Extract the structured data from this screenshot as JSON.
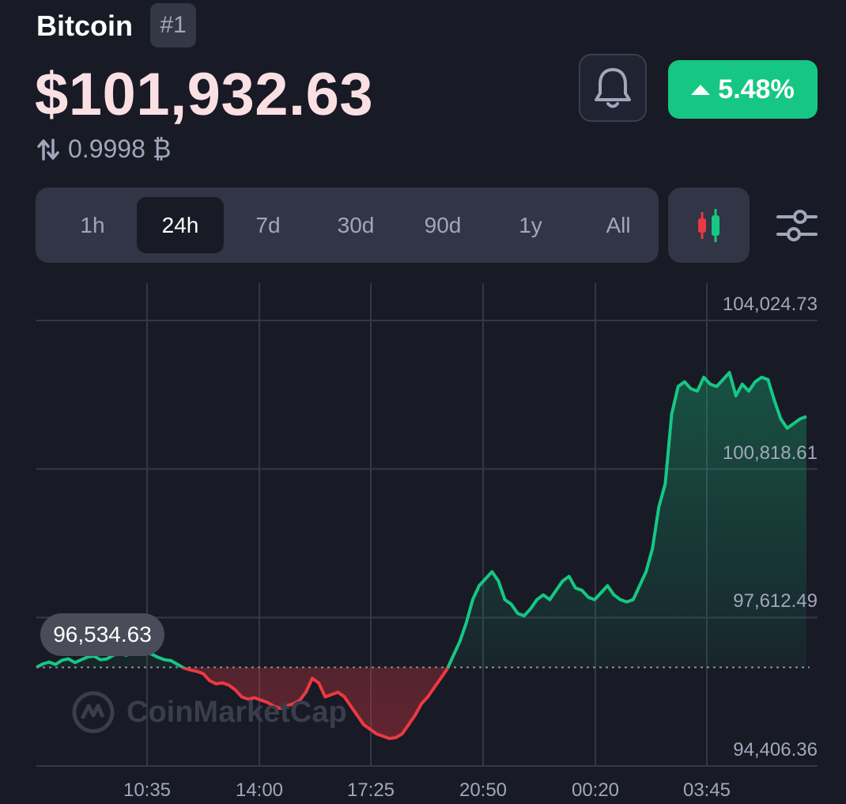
{
  "header": {
    "coin_name": "Bitcoin",
    "rank": "#1",
    "price": "$101,932.63",
    "btc_conversion": "0.9998 ₿",
    "change_percent": "5.48%"
  },
  "icons": {
    "swap": "swap-arrows-icon",
    "bell": "bell-icon",
    "change_direction": "triangle-up-icon",
    "candles": "candlestick-icon",
    "settings": "sliders-icon",
    "watermark_logo": "coinmarketcap-logo-icon"
  },
  "timeframes": [
    "1h",
    "24h",
    "7d",
    "30d",
    "90d",
    "1y",
    "All"
  ],
  "active_timeframe": "24h",
  "colors": {
    "up": "#16c784",
    "down": "#ea3943",
    "price_text": "#fbe0e3",
    "background": "#181a25",
    "panel": "#323546"
  },
  "watermark": "CoinMarketCap",
  "chart_data": {
    "type": "line",
    "y_ticks": [
      "104,024.73",
      "100,818.61",
      "97,612.49",
      "94,406.36"
    ],
    "x_ticks": [
      "10:35",
      "14:00",
      "17:25",
      "20:50",
      "00:20",
      "03:45"
    ],
    "ylim": [
      94406.36,
      104024.73
    ],
    "reference_value": 96534.63,
    "reference_label": "96,534.63",
    "grid": true,
    "series": [
      {
        "values": [
          96534.6,
          96610,
          96650,
          96600,
          96690,
          96720,
          96640,
          96700,
          96760,
          96780,
          96700,
          96720,
          96800,
          96850,
          96800,
          96850,
          96900,
          96860,
          96820,
          96750,
          96700,
          96680,
          96600,
          96520,
          96480,
          96450,
          96400,
          96250,
          96180,
          96200,
          96150,
          96050,
          95900,
          95850,
          95880,
          95830,
          95780,
          95700,
          95650,
          95700,
          95750,
          95820,
          96000,
          96300,
          96200,
          95900,
          95950,
          96000,
          95900,
          95700,
          95500,
          95300,
          95200,
          95100,
          95050,
          95000,
          95020,
          95100,
          95300,
          95500,
          95750,
          95900,
          96100,
          96300,
          96500,
          96800,
          97100,
          97500,
          98000,
          98300,
          98450,
          98600,
          98400,
          98000,
          97900,
          97700,
          97650,
          97800,
          98000,
          98100,
          98000,
          98200,
          98400,
          98500,
          98250,
          98200,
          98050,
          98000,
          98150,
          98300,
          98100,
          98000,
          97950,
          98000,
          98300,
          98600,
          99100,
          100000,
          100500,
          102000,
          102600,
          102700,
          102550,
          102500,
          102800,
          102650,
          102600,
          102750,
          102900,
          102400,
          102650,
          102500,
          102700,
          102800,
          102750,
          102300,
          101900,
          101700,
          101800,
          101900,
          101950
        ]
      }
    ]
  }
}
